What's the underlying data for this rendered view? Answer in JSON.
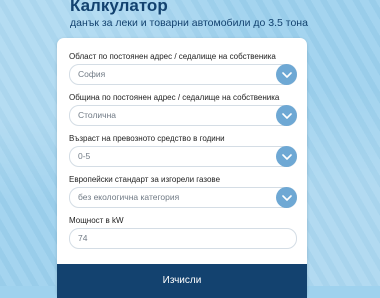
{
  "header": {
    "title": "Калкулатор",
    "subtitle": "данък за леки и товарни автомобили до 3.5 тона"
  },
  "form": {
    "fields": [
      {
        "label": "Област по постоянен адрес / седалище на собственика",
        "value": "София"
      },
      {
        "label": "Община по постоянен адрес / седалище на собственика",
        "value": "Столична"
      },
      {
        "label": "Възраст на превозното средство в години",
        "value": "0-5"
      },
      {
        "label": "Европейски стандарт за изгорели газове",
        "value": "без екологична категория"
      },
      {
        "label": "Мощност в kW",
        "value": "74"
      }
    ],
    "submit_label": "Изчисли"
  },
  "colors": {
    "accent": "#13426f",
    "chevron": "#6ea8d4",
    "background": "#a4d4ef"
  }
}
